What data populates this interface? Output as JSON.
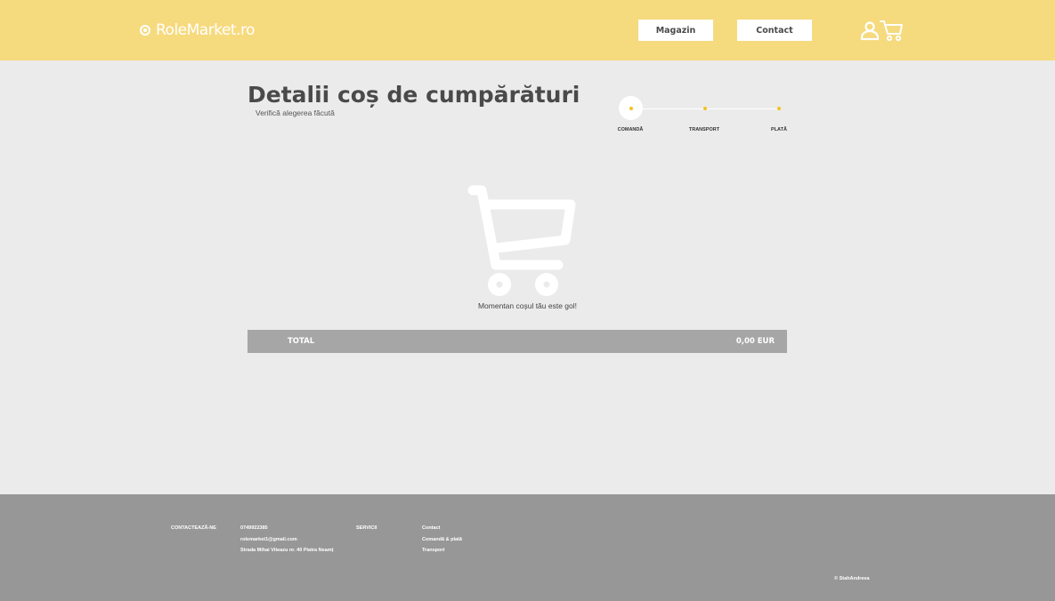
{
  "header": {
    "logo_text": "RoleMarket.ro",
    "nav": {
      "shop_label": "Magazin",
      "contact_label": "Contact"
    },
    "icons": [
      "user-icon",
      "cart-icon"
    ]
  },
  "page": {
    "title": "Detalii coș de cumpărături",
    "subtitle": "Verifică alegerea făcută"
  },
  "steps": [
    "COMANDĂ",
    "TRANSPORT",
    "PLATĂ"
  ],
  "cart": {
    "empty_message": "Momentan coșul tău este gol!",
    "total_label": "TOTAL",
    "total_value": "0,00 EUR"
  },
  "footer": {
    "contact_heading": "CONTACTEAZĂ-NE",
    "phone": "0749922385",
    "email": "rolemarket1@gmail.com",
    "address": "Strada Mihai Viteazu nr. 40 Piatra Neamț",
    "services_heading": "SERVICII",
    "links": [
      "Contact",
      "Comandă & plată",
      "Transport"
    ],
    "copyright": "© StahAndreea"
  },
  "colors": {
    "header_bg": "#f6da7e",
    "accent": "#f2c31c",
    "page_bg": "#ebebeb",
    "total_bar_bg": "#a6a6a6",
    "footer_bg": "#979797"
  }
}
